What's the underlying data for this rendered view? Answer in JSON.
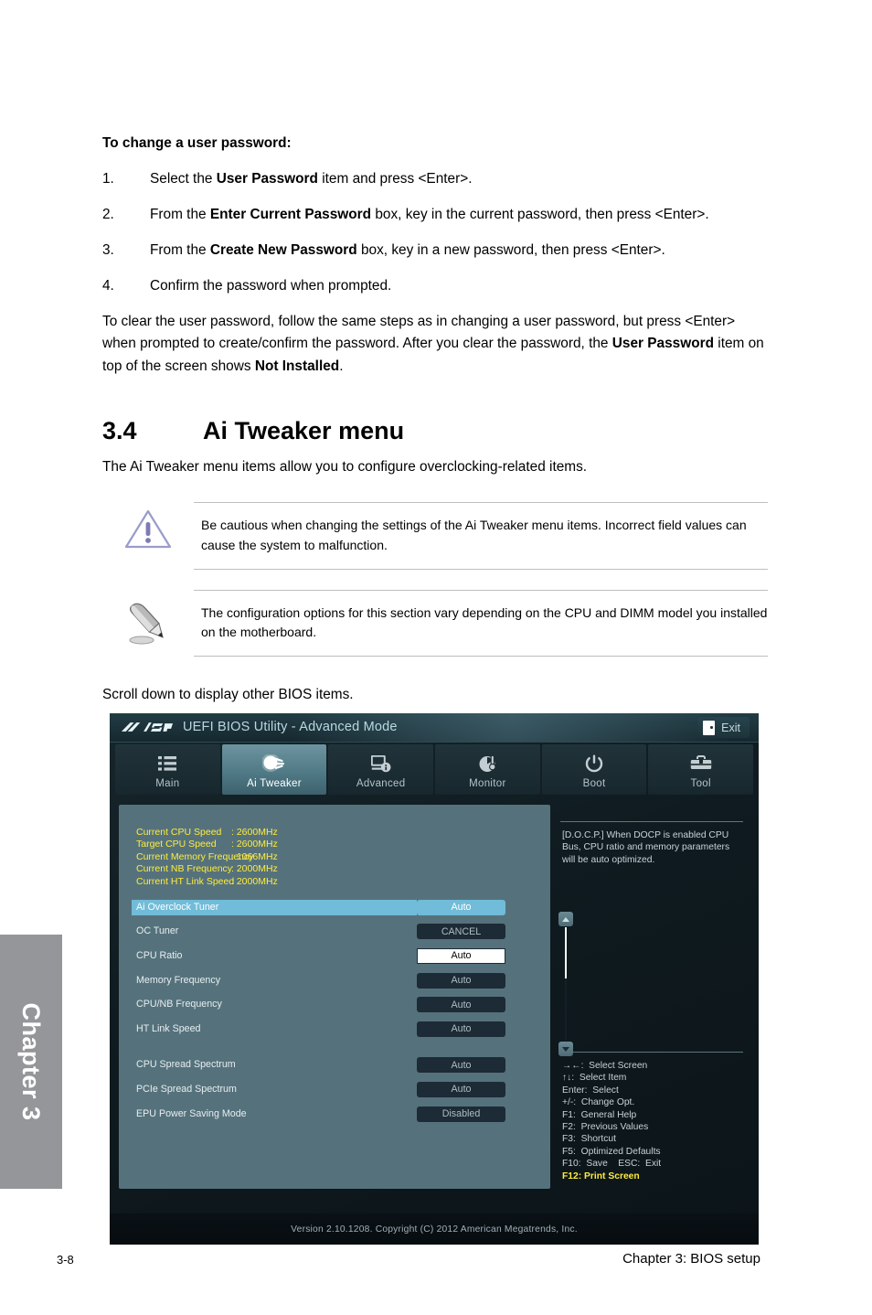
{
  "document": {
    "heading": "To change a user password:",
    "steps": [
      {
        "num": "1.",
        "pre": "Select the ",
        "bold": "User Password",
        "post": " item and press <Enter>."
      },
      {
        "num": "2.",
        "pre": "From the ",
        "bold": "Enter Current Password",
        "post": " box, key in the current password, then press <Enter>."
      },
      {
        "num": "3.",
        "pre": "From the ",
        "bold": "Create New Password",
        "post": " box, key in a new password, then press <Enter>."
      },
      {
        "num": "4.",
        "pre": "Confirm the password when prompted.",
        "bold": "",
        "post": ""
      }
    ],
    "clear_para_1": "To clear the user password, follow the same steps as in changing a user password, but press <Enter> when prompted to create/confirm the password. After you clear the password, the ",
    "clear_para_bold_1": "User Password",
    "clear_para_2": " item on top of the screen shows ",
    "clear_para_bold_2": "Not Installed",
    "clear_para_3": ".",
    "section_number": "3.4",
    "section_title": "Ai Tweaker menu",
    "section_intro": "The Ai Tweaker menu items allow you to configure overclocking-related items.",
    "caution_note": "Be cautious when changing the settings of the Ai Tweaker menu items. Incorrect field values can cause the system to malfunction.",
    "pencil_note": "The configuration options for this section vary depending on the CPU and DIMM model you installed on the motherboard.",
    "scroll_hint": "Scroll down to display other BIOS items.",
    "chapter_tab": "Chapter 3",
    "page_number": "3-8",
    "footer_right": "Chapter 3: BIOS setup"
  },
  "bios": {
    "brand": "ASUS",
    "title": "UEFI BIOS Utility - Advanced Mode",
    "exit_label": "Exit",
    "tabs": [
      {
        "label": "Main",
        "icon": "list-icon",
        "active": false
      },
      {
        "label": "Ai  Tweaker",
        "icon": "tweaker-icon",
        "active": true
      },
      {
        "label": "Advanced",
        "icon": "advanced-icon",
        "active": false
      },
      {
        "label": "Monitor",
        "icon": "monitor-icon",
        "active": false
      },
      {
        "label": "Boot",
        "icon": "power-icon",
        "active": false
      },
      {
        "label": "Tool",
        "icon": "toolbox-icon",
        "active": false
      }
    ],
    "system_info": [
      {
        "key": "Current CPU Speed",
        "value": ": 2600MHz"
      },
      {
        "key": "Target CPU Speed",
        "value": ": 2600MHz"
      },
      {
        "key": "Current Memory Frequency",
        "value": ": 1066MHz"
      },
      {
        "key": "Current NB Frequency",
        "value": ": 2000MHz"
      },
      {
        "key": "Current HT Link Speed",
        "value": ": 2000MHz"
      }
    ],
    "settings": [
      {
        "label": "Ai Overclock Tuner",
        "value": "Auto",
        "state": "selected"
      },
      {
        "label": "OC Tuner",
        "value": "CANCEL",
        "state": "normal"
      },
      {
        "label": "CPU Ratio",
        "value": "Auto",
        "state": "editing"
      },
      {
        "label": "Memory Frequency",
        "value": "Auto",
        "state": "normal"
      },
      {
        "label": "CPU/NB Frequency",
        "value": "Auto",
        "state": "normal"
      },
      {
        "label": "HT Link Speed",
        "value": "Auto",
        "state": "normal"
      },
      {
        "label": "",
        "value": "",
        "state": "gap"
      },
      {
        "label": "CPU Spread Spectrum",
        "value": "Auto",
        "state": "normal"
      },
      {
        "label": "PCIe Spread Spectrum",
        "value": "Auto",
        "state": "normal"
      },
      {
        "label": "EPU Power Saving Mode",
        "value": "Disabled",
        "state": "normal"
      }
    ],
    "help_text": "[D.O.C.P.] When DOCP is enabled CPU Bus, CPU ratio and memory parameters will be auto optimized.",
    "key_legend": [
      {
        "text": "→←:  Select Screen",
        "highlight": false
      },
      {
        "text": "↑↓:  Select Item",
        "highlight": false
      },
      {
        "text": "Enter:  Select",
        "highlight": false
      },
      {
        "text": "+/-:  Change Opt.",
        "highlight": false
      },
      {
        "text": "F1:  General Help",
        "highlight": false
      },
      {
        "text": "F2:  Previous Values",
        "highlight": false
      },
      {
        "text": "F3:  Shortcut",
        "highlight": false
      },
      {
        "text": "F5:  Optimized Defaults",
        "highlight": false
      },
      {
        "text": "F10:  Save    ESC:  Exit",
        "highlight": false
      },
      {
        "text": "F12: Print Screen",
        "highlight": true
      }
    ],
    "footer_version": "Version  2.10.1208.   Copyright  (C)  2012  American  Megatrends,  Inc.",
    "colors": {
      "accent_selected": "#71bcd8",
      "sysinfo_yellow": "#ffec3d",
      "panel_left_bg": "#55727c",
      "value_bg": "#1d2b36"
    }
  }
}
